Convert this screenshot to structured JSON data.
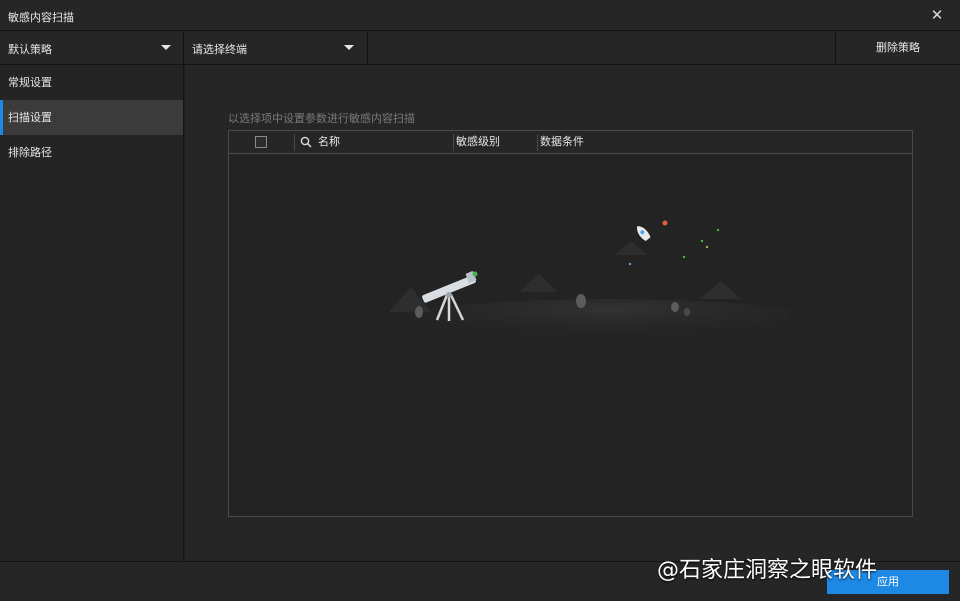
{
  "window": {
    "title": "敏感内容扫描",
    "close_icon": "close-icon"
  },
  "toolbar": {
    "policy_select": "默认策略",
    "terminal_select": "请选择终端",
    "delete_button": "删除策略"
  },
  "sidebar": {
    "items": [
      {
        "label": "常规设置",
        "active": false
      },
      {
        "label": "扫描设置",
        "active": true
      },
      {
        "label": "排除路径",
        "active": false
      }
    ]
  },
  "main": {
    "hint": "以选择项中设置参数进行敏感内容扫描",
    "table": {
      "columns": [
        "名称",
        "敏感级别",
        "数据条件"
      ],
      "rows": [],
      "empty_illustration": "telescope-empty-state"
    }
  },
  "footer": {
    "apply_button": "应用"
  },
  "watermark": {
    "text": "@石家庄洞察之眼软件"
  },
  "colors": {
    "accent": "#1e88e5",
    "background": "#262626",
    "border": "#4a4a4a"
  }
}
